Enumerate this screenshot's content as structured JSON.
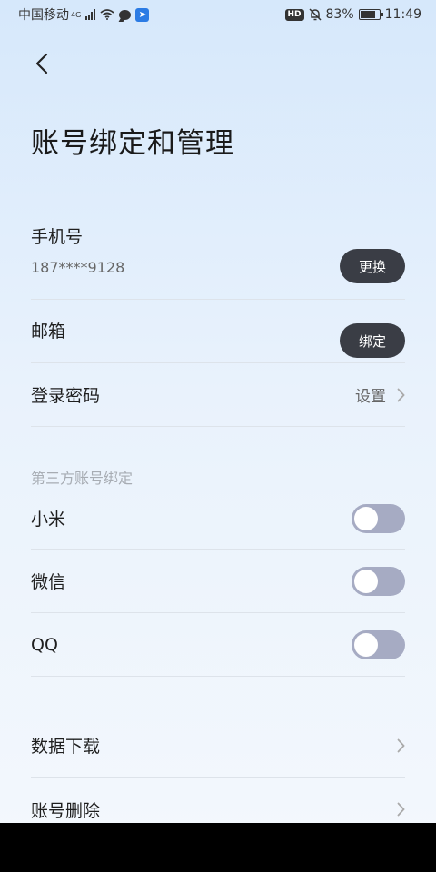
{
  "status_bar": {
    "carrier": "中国移动",
    "network": "4G",
    "battery": "83%",
    "battery_level": 0.83,
    "time": "11:49",
    "hd": "HD"
  },
  "header": {
    "title": "账号绑定和管理"
  },
  "account": {
    "phone": {
      "label": "手机号",
      "value": "187****9128",
      "button": "更换"
    },
    "email": {
      "label": "邮箱",
      "button": "绑定"
    },
    "password": {
      "label": "登录密码",
      "value": "设置"
    }
  },
  "third_party": {
    "section_title": "第三方账号绑定",
    "items": [
      {
        "label": "小米",
        "enabled": false
      },
      {
        "label": "微信",
        "enabled": false
      },
      {
        "label": "QQ",
        "enabled": false
      }
    ]
  },
  "actions": [
    {
      "label": "数据下载"
    },
    {
      "label": "账号删除"
    }
  ],
  "colors": {
    "accent_button": "#3a3d45",
    "toggle_off": "#a6abc3",
    "divider": "#dde3ea"
  }
}
